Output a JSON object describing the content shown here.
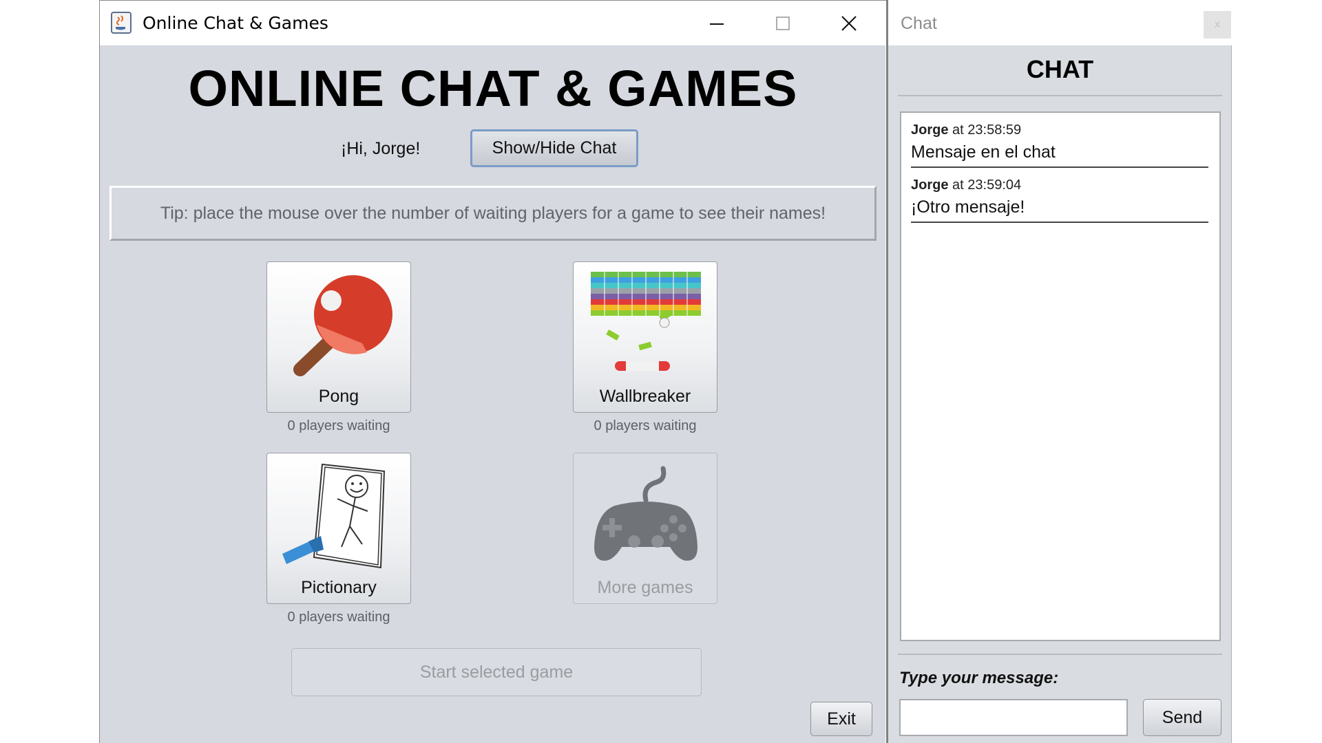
{
  "main_window": {
    "title": "Online Chat & Games",
    "heading": "ONLINE CHAT & GAMES",
    "greeting": "¡Hi, Jorge!",
    "toggle_chat_label": "Show/Hide Chat",
    "tip": "Tip: place the mouse over the number of waiting players for a game to see their names!",
    "games": [
      {
        "label": "Pong",
        "waiting": "0 players waiting",
        "icon": "ping-pong-paddle-icon"
      },
      {
        "label": "Wallbreaker",
        "waiting": "0 players waiting",
        "icon": "brick-breaker-icon"
      },
      {
        "label": "Pictionary",
        "waiting": "0 players waiting",
        "icon": "drawing-icon"
      },
      {
        "label": "More games",
        "icon": "gamepad-icon",
        "disabled": true
      }
    ],
    "start_label": "Start selected game",
    "exit_label": "Exit",
    "window_controls": [
      "minimize-icon",
      "maximize-icon",
      "close-icon"
    ]
  },
  "chat_window": {
    "title": "Chat",
    "heading": "CHAT",
    "messages": [
      {
        "user": "Jorge",
        "at": "at 23:58:59",
        "text": "Mensaje en el chat"
      },
      {
        "user": "Jorge",
        "at": "at 23:59:04",
        "text": "¡Otro mensaje!"
      }
    ],
    "input_label": "Type your message:",
    "input_value": "",
    "send_label": "Send",
    "close_glyph": "x"
  },
  "colors": {
    "window_bg": "#d6d9e0",
    "paddle_red": "#d63c2a",
    "focus_border": "#7a9cc7"
  }
}
